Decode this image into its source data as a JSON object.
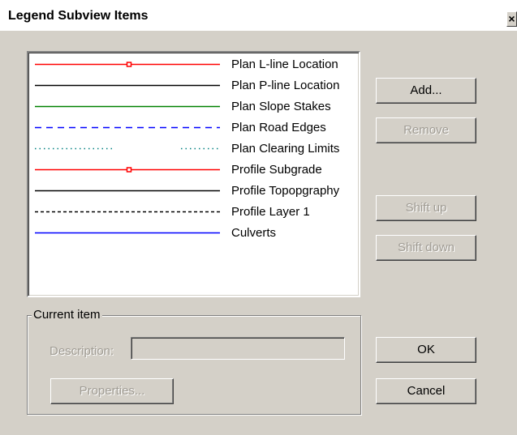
{
  "dialog": {
    "title": "Legend Subview Items",
    "close_label": "×"
  },
  "legend_items": [
    {
      "label": "Plan L-line Location",
      "color": "#ff0000",
      "style": "solid",
      "marker": true
    },
    {
      "label": "Plan P-line Location",
      "color": "#000000",
      "style": "solid",
      "marker": false
    },
    {
      "label": "Plan Slope Stakes",
      "color": "#008000",
      "style": "solid",
      "marker": false
    },
    {
      "label": "Plan Road Edges",
      "color": "#0000ff",
      "style": "dashed",
      "marker": false
    },
    {
      "label": "Plan Clearing Limits",
      "color": "#008080",
      "style": "dotted-gap",
      "marker": false
    },
    {
      "label": "Profile Subgrade",
      "color": "#ff0000",
      "style": "solid",
      "marker": true
    },
    {
      "label": "Profile Topopgraphy",
      "color": "#000000",
      "style": "solid",
      "marker": false
    },
    {
      "label": "Profile Layer 1",
      "color": "#000000",
      "style": "dashed-fine",
      "marker": false
    },
    {
      "label": "Culverts",
      "color": "#0000ff",
      "style": "solid",
      "marker": false
    }
  ],
  "buttons": {
    "add": "Add...",
    "remove": "Remove",
    "shift_up": "Shift up",
    "shift_down": "Shift down",
    "ok": "OK",
    "cancel": "Cancel",
    "properties": "Properties..."
  },
  "current_item": {
    "group_label": "Current item",
    "description_label": "Description:",
    "description_value": ""
  }
}
